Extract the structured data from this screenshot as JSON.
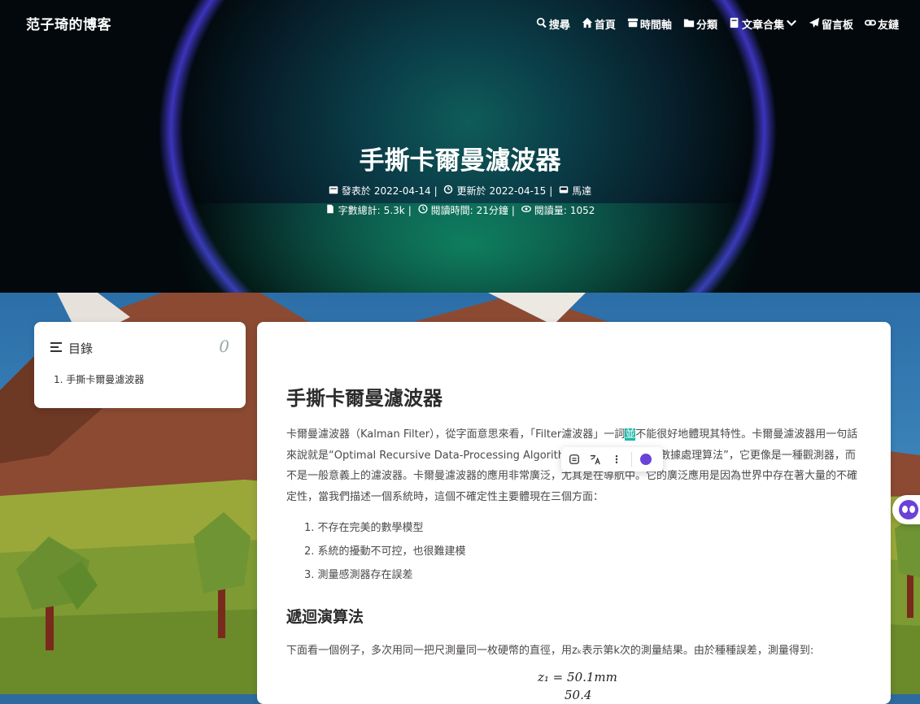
{
  "site": {
    "brand": "范子琦的博客"
  },
  "nav": [
    {
      "label": "搜尋",
      "icon": "search-icon"
    },
    {
      "label": "首頁",
      "icon": "home-icon"
    },
    {
      "label": "時間軸",
      "icon": "archive-icon"
    },
    {
      "label": "分類",
      "icon": "folder-icon"
    },
    {
      "label": "文章合集",
      "icon": "book-icon"
    },
    {
      "label": "留言板",
      "icon": "paper-plane-icon"
    },
    {
      "label": "友鏈",
      "icon": "link-icon"
    }
  ],
  "post": {
    "title": "手撕卡爾曼濾波器",
    "published_label": "發表於",
    "published": "2022-04-14",
    "updated_label": "更新於",
    "updated": "2022-04-15",
    "author": "馬達",
    "wordcount_label": "字數總計:",
    "wordcount": "5.3k",
    "readtime_label": "閱讀時間:",
    "readtime": "21分鐘",
    "views_label": "閱讀量:",
    "views": "1052"
  },
  "toc": {
    "title": "目錄",
    "count": "0",
    "items": [
      "1. 手撕卡爾曼濾波器"
    ]
  },
  "article": {
    "heading": "手撕卡爾曼濾波器",
    "p1_a": "卡爾曼濾波器（Kalman Filter），從字面意思來看，「Filter濾波器」一詞",
    "p1_hl": "並",
    "p1_b": "不能很好地體現其特性。卡爾曼濾波器用一句話來說就是“Optimal Recursive Data-Processing Algorithm”，即為“最優遞歸數據處理算法”，它更像是一種觀測器，而不是一般意義上的濾波器。卡爾曼濾波器的應用非常廣泛，尤其是在導航中。它的廣泛應用是因為世界中存在著大量的不確定性，當我們描述一個系統時，這個不確定性主要體現在三個方面：",
    "list": [
      "1. 不存在完美的數學模型",
      "2. 系統的擾動不可控，也很難建模",
      "3. 測量感測器存在誤差"
    ],
    "h2": "遞迴演算法",
    "p2": "下面看一個例子，多次用同一把尺測量同一枚硬幣的直徑，用zₖ表示第k次的測量結果。由於種種誤差，測量得到:",
    "eq1": "z₁ = 50.1mm",
    "eq2": "50.4"
  },
  "colors": {
    "accent": "#1fb8a9",
    "bot": "#6a42d8"
  }
}
